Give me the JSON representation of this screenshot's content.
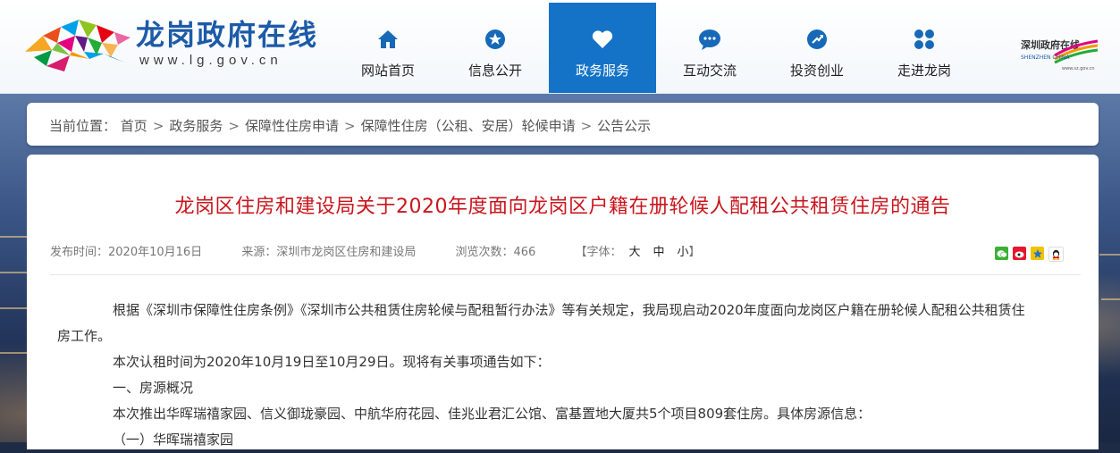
{
  "site": {
    "name": "龙岗政府在线",
    "url": "www.lg.gov.cn"
  },
  "nav": [
    {
      "label": "网站首页",
      "icon": "home-icon"
    },
    {
      "label": "信息公开",
      "icon": "info-star-icon"
    },
    {
      "label": "政务服务",
      "icon": "heart-icon",
      "active": true
    },
    {
      "label": "互动交流",
      "icon": "chat-bubble-icon"
    },
    {
      "label": "投资创业",
      "icon": "investment-icon"
    },
    {
      "label": "走进龙岗",
      "icon": "grid-dots-icon"
    }
  ],
  "shenzhen_logo": {
    "text": "深圳政府在线",
    "sub": "SHENZHEN CHINA",
    "url": "www.sz.gov.cn"
  },
  "breadcrumb": {
    "prefix": "当前位置：",
    "items": [
      "首页",
      "政务服务",
      "保障性住房申请",
      "保障性住房（公租、安居）轮候申请",
      "公告公示"
    ]
  },
  "article": {
    "title": "龙岗区住房和建设局关于2020年度面向龙岗区户籍在册轮候人配租公共租赁住房的通告",
    "publish_label": "发布时间：",
    "publish_date": "2020年10月16日",
    "source_label": "来源：",
    "source": "深圳市龙岗区住房和建设局",
    "views_label": "浏览次数：",
    "views": "466",
    "font_label": "【字体：",
    "font_large": "大",
    "font_medium": "中",
    "font_small": "小",
    "font_close": "】",
    "paragraphs": [
      "根据《深圳市保障性住房条例》《深圳市公共租赁住房轮候与配租暂行办法》等有关规定，我局现启动2020年度面向龙岗区户籍在册轮候人配租公共租赁住",
      "房工作。",
      "本次认租时间为2020年10月19日至10月29日。现将有关事项通告如下：",
      "一、房源概况",
      "本次推出华晖瑞禧家园、信义御珑豪园、中航华府花园、佳兆业君汇公馆、富基置地大厦共5个项目809套住房。具体房源信息：",
      "（一）华晖瑞禧家园"
    ]
  },
  "share_icons": [
    "wechat-icon",
    "weibo-icon",
    "qzone-icon",
    "qq-icon"
  ],
  "colors": {
    "brand_blue": "#1d5aa8",
    "nav_active": "#1473c6",
    "title_red": "#c8161d"
  }
}
